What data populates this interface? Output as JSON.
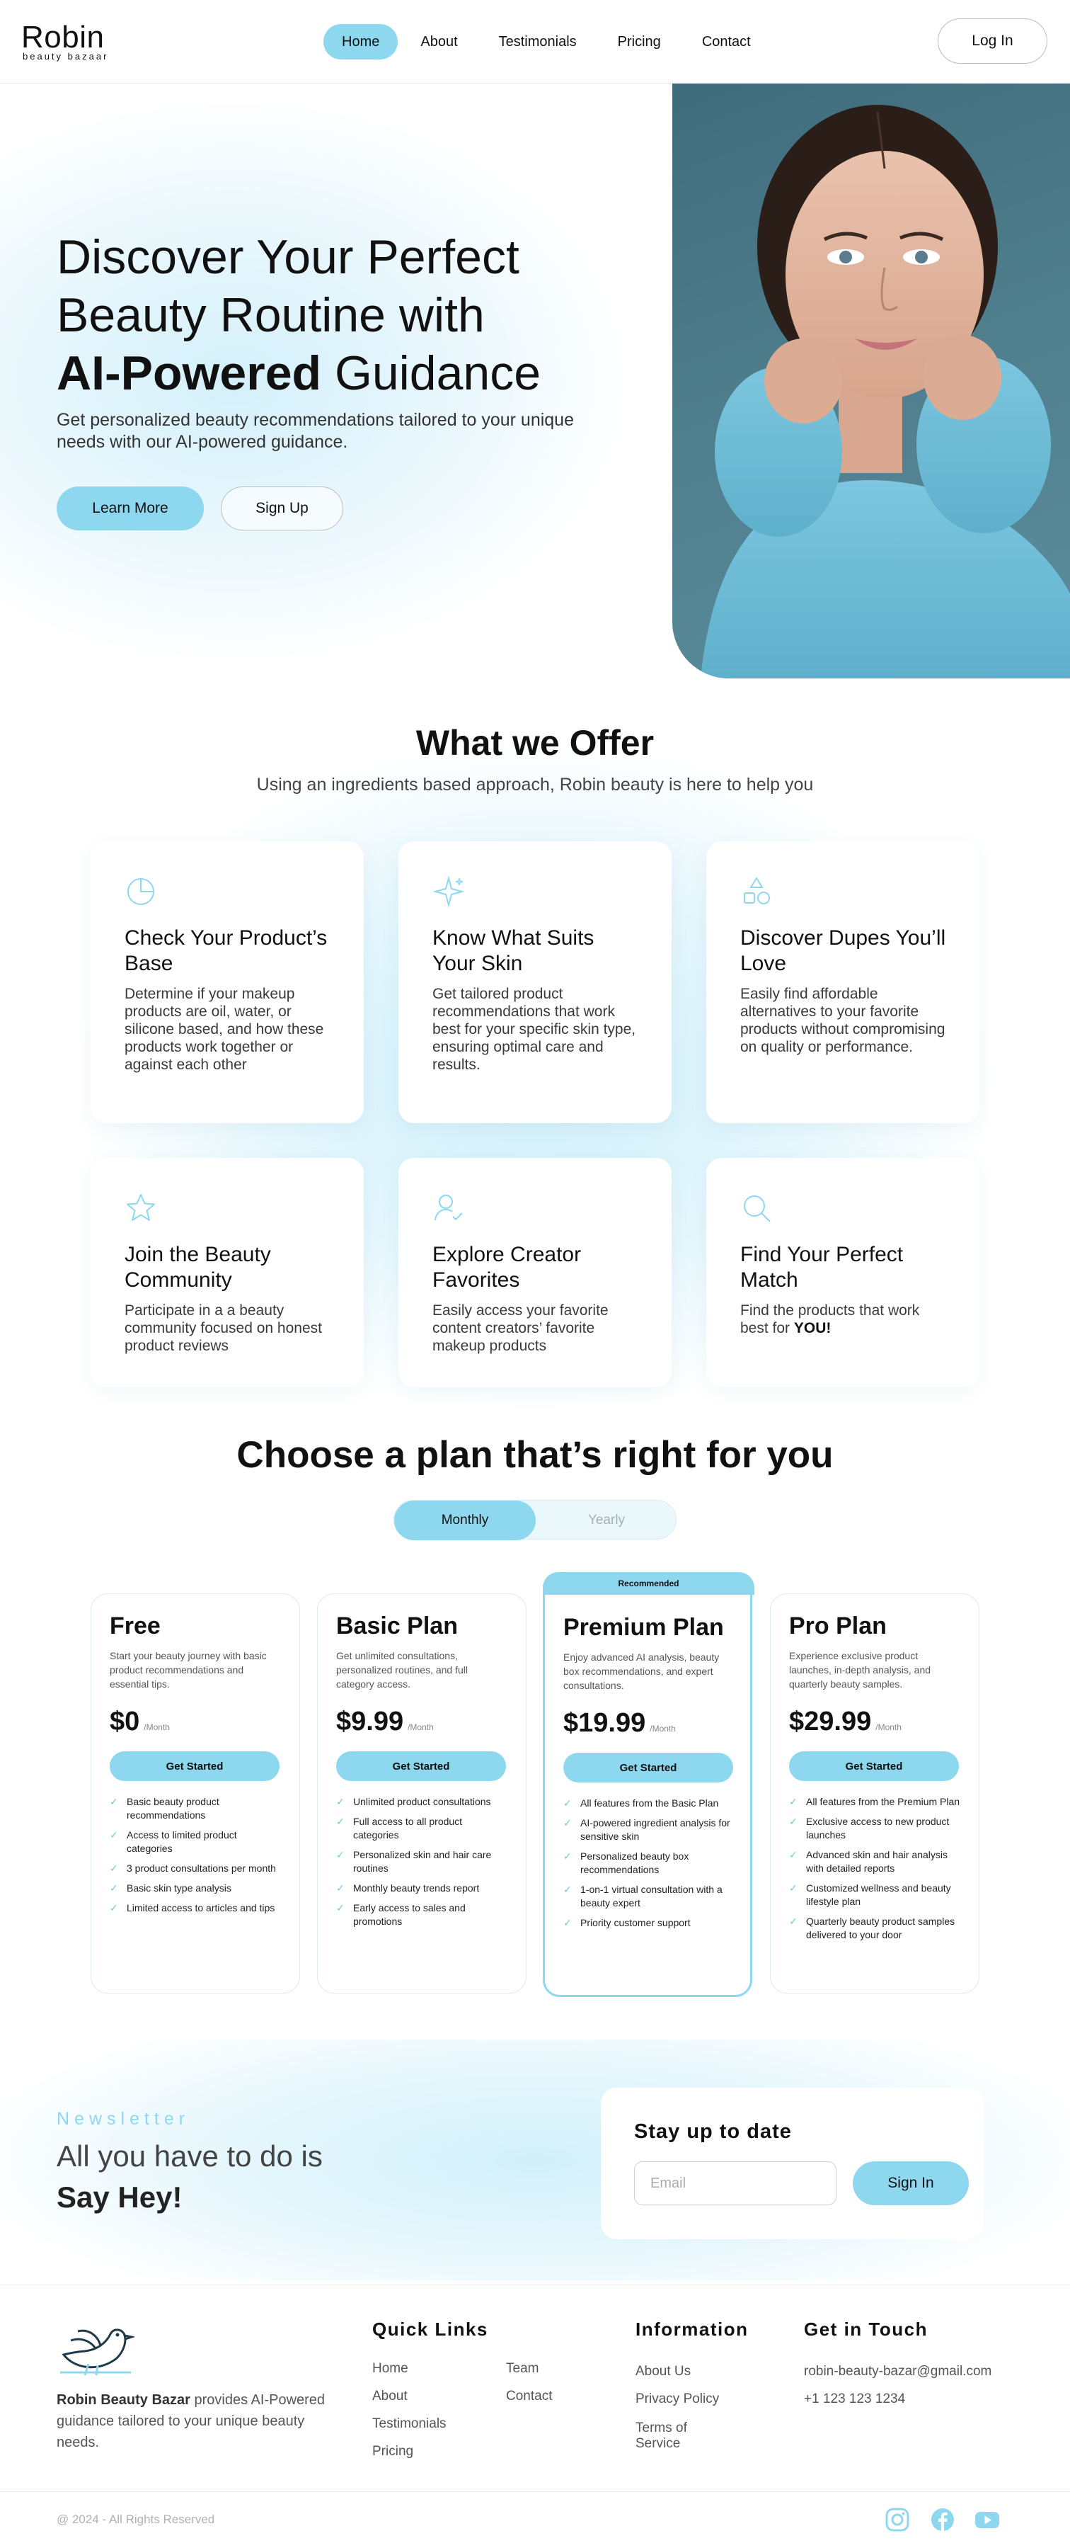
{
  "brand": {
    "name": "Robin",
    "tagline": "beauty bazaar"
  },
  "nav": {
    "items": [
      "Home",
      "About",
      "Testimonials",
      "Pricing",
      "Contact"
    ],
    "active": "Home",
    "login_label": "Log In"
  },
  "hero": {
    "title_line1": "Discover Your Perfect",
    "title_line2": "Beauty Routine with",
    "title_bold": "AI-Powered",
    "title_end": " Guidance",
    "subtitle": "Get personalized beauty recommendations tailored to your unique needs with our AI-powered guidance.",
    "learn_more": "Learn More",
    "sign_up": "Sign Up"
  },
  "offer": {
    "title": "What we Offer",
    "subtitle": "Using an ingredients based approach, Robin beauty is here to help you",
    "cards": [
      {
        "icon": "pie-chart-icon",
        "title": "Check Your Product’s Base",
        "text": "Determine if your makeup products are oil, water, or silicone based, and how these products work together or against each other"
      },
      {
        "icon": "sparkle-icon",
        "title": "Know What Suits Your Skin",
        "text": "Get tailored product recommendations that work best for your specific skin type, ensuring optimal care and results."
      },
      {
        "icon": "shapes-icon",
        "title": "Discover Dupes You’ll Love",
        "text": "Easily find affordable alternatives to your favorite products without compromising on quality or performance."
      },
      {
        "icon": "star-icon",
        "title": "Join the Beauty Community",
        "text": "Participate in a a beauty community focused on honest product reviews"
      },
      {
        "icon": "user-check-icon",
        "title": "Explore Creator Favorites",
        "text": "Easily access your favorite content creators’ favorite makeup products"
      },
      {
        "icon": "search-icon",
        "title": "Find Your Perfect Match",
        "text": "Find the products that work best for ",
        "bold": "YOU!"
      }
    ]
  },
  "pricing": {
    "title_pre": "Choose a plan that’s ",
    "title_bold": "right for you",
    "toggle_on": "Monthly",
    "toggle_off": "Yearly",
    "recommended_label": "Recommended",
    "per": "/Month",
    "cta": "Get Started",
    "plans": [
      {
        "name": "Free",
        "desc": "Start your beauty journey with basic product recommendations and essential tips.",
        "price": "$0",
        "features": [
          "Basic beauty product recommendations",
          "Access to limited product categories",
          "3 product consultations per month",
          "Basic skin type analysis",
          "Limited access to articles and tips"
        ]
      },
      {
        "name": "Basic Plan",
        "desc": "Get unlimited consultations, personalized routines, and full category access.",
        "price": "$9.99",
        "features": [
          "Unlimited product consultations",
          "Full access to all product categories",
          "Personalized skin and hair care routines",
          "Monthly beauty trends report",
          "Early access to sales and promotions"
        ]
      },
      {
        "name": "Premium Plan",
        "desc": "Enjoy advanced AI analysis, beauty box recommendations, and expert consultations.",
        "price": "$19.99",
        "features": [
          "All features from the Basic Plan",
          "AI-powered ingredient analysis for sensitive skin",
          "Personalized beauty box recommendations",
          "1-on-1 virtual consultation with a beauty expert",
          "Priority customer support"
        ]
      },
      {
        "name": "Pro Plan",
        "desc": "Experience exclusive product launches, in-depth analysis, and quarterly beauty samples.",
        "price": "$29.99",
        "features": [
          "All features from the Premium Plan",
          "Exclusive access to new product launches",
          "Advanced skin and hair analysis with detailed reports",
          "Customized wellness and beauty lifestyle plan",
          "Quarterly beauty product samples delivered to your door"
        ]
      }
    ]
  },
  "newsletter": {
    "label": "Newsletter",
    "heading_pre": "All you have to do is ",
    "heading_bold": "Say Hey!",
    "box_title": "Stay up to date",
    "email_placeholder": "Email",
    "button": "Sign In"
  },
  "footer": {
    "brand_bold": "Robin Beauty Bazar",
    "about": " provides AI-Powered guidance tailored to your unique beauty needs.",
    "quick_links_title": "Quick Links",
    "quick_links_col1": [
      "Home",
      "About",
      "Testimonials",
      "Pricing"
    ],
    "quick_links_col2": [
      "Team",
      "Contact"
    ],
    "information_title": "Information",
    "information_links": [
      "About Us",
      "Privacy Policy",
      "Terms of Service"
    ],
    "contact_title": "Get in Touch",
    "email": "robin-beauty-bazar@gmail.com",
    "phone": "+1 123 123 1234",
    "copyright": "@ 2024 - All Rights Reserved",
    "social": [
      "instagram-icon",
      "facebook-icon",
      "youtube-icon"
    ]
  },
  "colors": {
    "accent": "#8ed8ef",
    "text": "#111111",
    "muted": "#555555"
  }
}
